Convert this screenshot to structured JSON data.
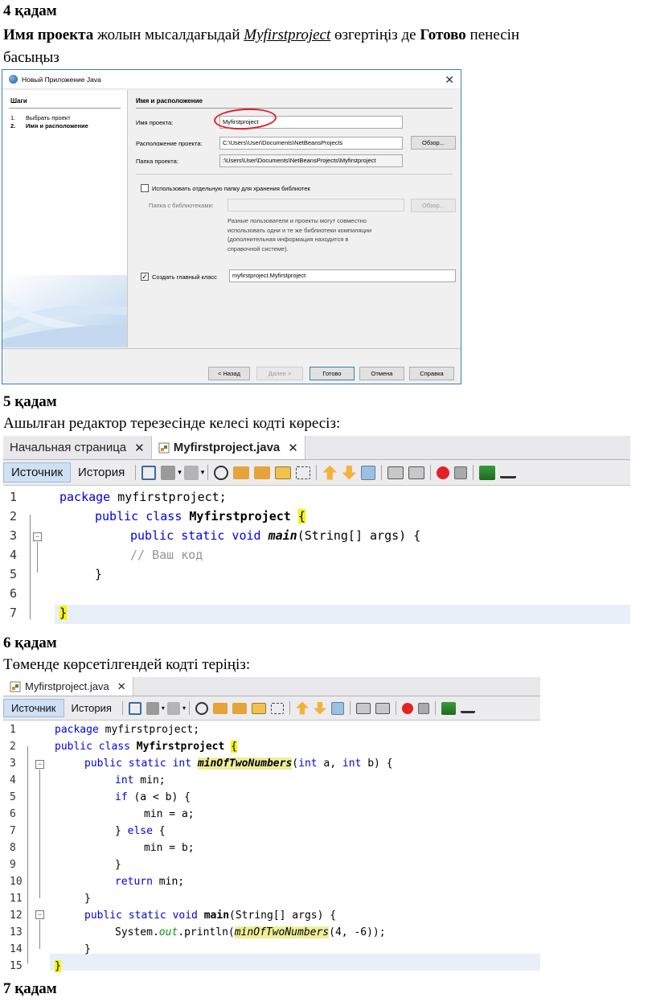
{
  "step4": {
    "title": "4 қадам",
    "instruction_bold1": "Имя проекта",
    "instruction_part1": " жолын мысалдағыдай ",
    "instruction_link": "Myfirstproject",
    "instruction_part2": " өзгертіңіз де ",
    "instruction_bold2": "Готово",
    "instruction_part3": " пенесін",
    "instruction_line2": "басыңыз"
  },
  "dialog": {
    "title": "Новый Приложение Java",
    "steps_header": "Шаги",
    "steps": [
      {
        "num": "1.",
        "label": "Выбрать проект"
      },
      {
        "num": "2.",
        "label": "Имя и расположение"
      }
    ],
    "section_header": "Имя и расположение",
    "project_name_label": "Имя проекта:",
    "project_name_value": "Myfirstproject",
    "location_label": "Расположение проекта:",
    "location_value": "C:\\Users\\User\\Documents\\NetBeansProjects",
    "folder_label": "Папка проекта:",
    "folder_value": ":\\Users\\User\\Documents\\NetBeansProjects\\Myfirstproject",
    "browse_label": "Обзор...",
    "separate_folder_label": "Использовать отдельную папку для хранения библиотек",
    "libraries_label": "Папка с библиотеками:",
    "note_lines": [
      "Разные пользователи и проекты могут совместно",
      "использовать одни и те же библиотеки компиляции",
      "(дополнительная информация находится в",
      "справочной системе)."
    ],
    "main_class_label": "Создать главный класс",
    "main_class_value": "myfirstproject.Myfirstproject",
    "buttons": {
      "back": "< Назад",
      "next": "Далее >",
      "finish": "Готово",
      "cancel": "Отмена",
      "help": "Справка"
    }
  },
  "step5": {
    "title": "5 қадам",
    "text": "Ашылған редактор терезесінде келесі кодті көресіз:"
  },
  "editor1": {
    "tabs": [
      "Начальная страница",
      "Myfirstproject.java"
    ],
    "toolbar": {
      "source": "Источник",
      "history": "История"
    },
    "line_numbers": [
      "1",
      "2",
      "3",
      "4",
      "5",
      "6",
      "7"
    ],
    "code": {
      "l1_kw": "package",
      "l1_rest": " myfirstproject;",
      "l2_kw": "public class",
      "l2_name": "Myfirstproject",
      "l2_brace": "{",
      "l3_kw": "public static void",
      "l3_name": "main",
      "l3_rest": "(String[] args) {",
      "l4_comment": "// Ваш код",
      "l5": "}",
      "l7": "}"
    }
  },
  "step6": {
    "title": "6 қадам",
    "text": "Төменде көрсетілгендей кодті теріңіз:"
  },
  "editor2": {
    "tabs": [
      "Myfirstproject.java"
    ],
    "toolbar": {
      "source": "Источник",
      "history": "История"
    },
    "line_numbers": [
      "1",
      "2",
      "3",
      "4",
      "5",
      "6",
      "7",
      "8",
      "9",
      "10",
      "11",
      "12",
      "13",
      "14",
      "15"
    ],
    "code": {
      "l1_kw": "package",
      "l1_rest": " myfirstproject;",
      "l2_kw": "public class",
      "l2_name": "Myfirstproject",
      "l2_brace": "{",
      "l3_kw": "public static int",
      "l3_name": "minOfTwoNumbers",
      "l3_p1": "(",
      "l3_int1": "int",
      "l3_p2": " a, ",
      "l3_int2": "int",
      "l3_p3": " b) {",
      "l4_kw": "int",
      "l4_rest": " min;",
      "l5_kw": "if",
      "l5_rest": " (a < b) {",
      "l6": "min = a;",
      "l7_p1": "} ",
      "l7_kw": "else",
      "l7_p2": " {",
      "l8": "min = b;",
      "l9": "}",
      "l10_kw": "return",
      "l10_rest": " min;",
      "l11": "}",
      "l12_kw": "public static void",
      "l12_name": "main",
      "l12_rest": "(String[] args) {",
      "l13_p1": "System.",
      "l13_field": "out",
      "l13_p2": ".println(",
      "l13_call": "minOfTwoNumbers",
      "l13_p3": "(4, -6));",
      "l14": "}",
      "l15": "}"
    }
  },
  "step7": {
    "title": "7 қадам"
  },
  "colors": {
    "keyword": "#0000e6",
    "comment": "#969696",
    "brace_highlight": "#f5f500",
    "usage_highlight": "#eeee9a",
    "current_line": "#e9eff8",
    "field": "#009900"
  }
}
